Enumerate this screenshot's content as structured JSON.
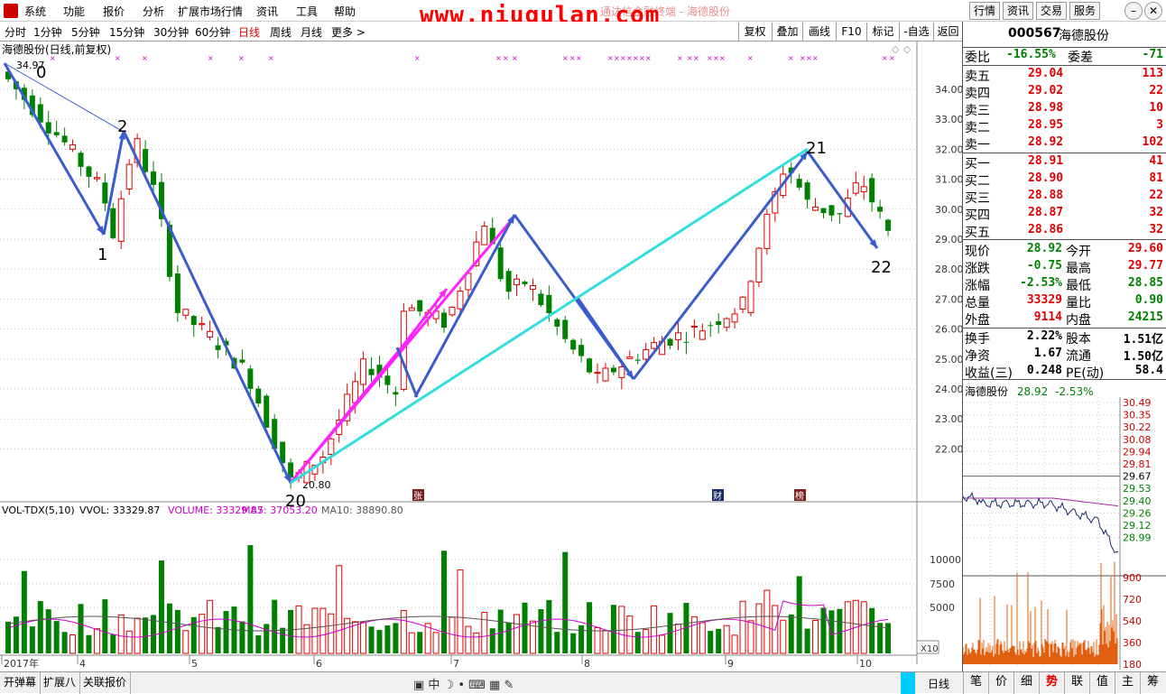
{
  "menu": [
    "系统",
    "功能",
    "报价",
    "分析",
    "扩展市场行情",
    "资讯",
    "工具",
    "帮助"
  ],
  "watermark": "www.niugulan.com",
  "bg_title": "通达信金融终端 - 海德股份",
  "top_buttons": [
    "行情",
    "资讯",
    "交易",
    "服务"
  ],
  "periods": [
    "分时",
    "1分钟",
    "5分钟",
    "15分钟",
    "30分钟",
    "60分钟",
    "日线",
    "周线",
    "月线",
    "更多 >"
  ],
  "active_period": "日线",
  "period_buttons": [
    "复权",
    "叠加",
    "画线",
    "F10",
    "标记",
    "-自选",
    "返回"
  ],
  "chart_title": "海德股份(日线,前复权)",
  "high_label": "34.97",
  "low_label": "20.80",
  "wave_labels": [
    {
      "t": "0"
    },
    {
      "t": "1"
    },
    {
      "t": "2"
    },
    {
      "t": "20"
    },
    {
      "t": "21"
    },
    {
      "t": "22"
    }
  ],
  "price_ticks": [
    "34.00",
    "33.00",
    "32.00",
    "31.00",
    "30.00",
    "29.00",
    "28.00",
    "27.00",
    "26.00",
    "25.00",
    "24.00",
    "23.00",
    "22.00"
  ],
  "vol_legend": {
    "name": "VOL-TDX(5,10)",
    "vvol": "VVOL: 33329.87",
    "volume": "VOLUME: 33329.87",
    "ma5": "MA5: 37053.20",
    "ma10": "MA10: 38890.80"
  },
  "vol_ticks": [
    "10000",
    "7500",
    "5000"
  ],
  "vol_unit": "X10",
  "events": [
    "张",
    "财",
    "榜"
  ],
  "date_labels": [
    "2017年",
    "4",
    "5",
    "6",
    "7",
    "8",
    "9",
    "10"
  ],
  "quote": {
    "code": "000567",
    "name": "海德股份",
    "weibi_label": "委比",
    "weibi": "-16.55%",
    "weicha_label": "委差",
    "weicha": "-71",
    "sell": [
      {
        "l": "卖五",
        "p": "29.04",
        "v": "113"
      },
      {
        "l": "卖四",
        "p": "29.02",
        "v": "22"
      },
      {
        "l": "卖三",
        "p": "28.98",
        "v": "10"
      },
      {
        "l": "卖二",
        "p": "28.95",
        "v": "3"
      },
      {
        "l": "卖一",
        "p": "28.92",
        "v": "102"
      }
    ],
    "buy": [
      {
        "l": "买一",
        "p": "28.91",
        "v": "41"
      },
      {
        "l": "买二",
        "p": "28.90",
        "v": "81"
      },
      {
        "l": "买三",
        "p": "28.88",
        "v": "22"
      },
      {
        "l": "买四",
        "p": "28.87",
        "v": "32"
      },
      {
        "l": "买五",
        "p": "28.86",
        "v": "32"
      }
    ],
    "stats": [
      {
        "l1": "现价",
        "v1": "28.92",
        "l2": "今开",
        "v2": "29.60",
        "c1": "green",
        "c2": "red"
      },
      {
        "l1": "涨跌",
        "v1": "-0.75",
        "l2": "最高",
        "v2": "29.77",
        "c1": "green",
        "c2": "red"
      },
      {
        "l1": "涨幅",
        "v1": "-2.53%",
        "l2": "最低",
        "v2": "28.85",
        "c1": "green",
        "c2": "green"
      },
      {
        "l1": "总量",
        "v1": "33329",
        "l2": "量比",
        "v2": "0.90",
        "c1": "red",
        "c2": "green"
      },
      {
        "l1": "外盘",
        "v1": "9114",
        "l2": "内盘",
        "v2": "24215",
        "c1": "red",
        "c2": "green"
      }
    ],
    "stats2": [
      {
        "l1": "换手",
        "v1": "2.22%",
        "l2": "股本",
        "v2": "1.51亿"
      },
      {
        "l1": "净资",
        "v1": "1.67",
        "l2": "流通",
        "v2": "1.50亿"
      },
      {
        "l1": "收益(三)",
        "v1": "0.248",
        "l2": "PE(动)",
        "v2": "58.4"
      }
    ]
  },
  "mini": {
    "name": "海德股份",
    "price": "28.92",
    "pct": "-2.53%",
    "ticks": [
      "30.49",
      "30.35",
      "30.22",
      "30.08",
      "29.94",
      "29.81",
      "29.67",
      "29.53",
      "29.40",
      "29.26",
      "29.12",
      "28.99"
    ],
    "vol_ticks": [
      "900",
      "720",
      "540",
      "360",
      "180"
    ]
  },
  "bottom_left": [
    "开弹幕",
    "扩展八",
    "关联报价"
  ],
  "bottom_right_tabs": [
    "笔",
    "价",
    "细",
    "势",
    "联",
    "值",
    "主",
    "筹"
  ],
  "bottom_daybtn": "日线",
  "colors": {
    "up": "#e00000",
    "down": "#008000",
    "wave": "#3a5ccc",
    "magenta": "#ff22ff",
    "cyan": "#33dddd"
  }
}
